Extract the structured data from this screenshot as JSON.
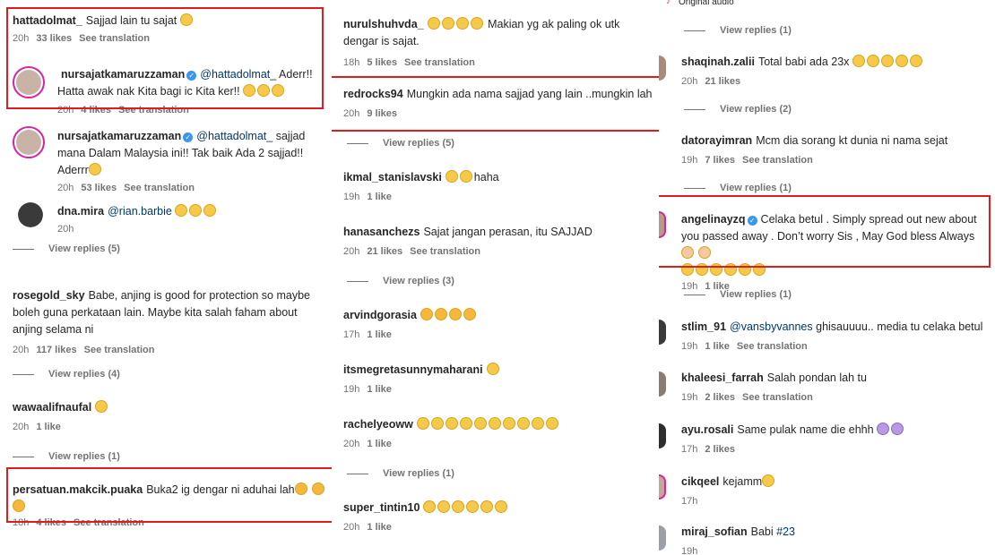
{
  "col1": {
    "c1": {
      "user": "hattadolmat_",
      "text": "Sajjad lain tu sajat",
      "time": "20h",
      "likes": "33 likes",
      "see": "See translation"
    },
    "c2": {
      "user": "nursajatkamaruzzaman",
      "mention": "@hattadolmat_",
      "text": "Aderr!! Hatta awak nak Kita bagi ic Kita ker!!",
      "time": "20h",
      "likes": "4 likes",
      "see": "See translation"
    },
    "c3": {
      "user": "nursajatkamaruzzaman",
      "mention": "@hattadolmat_",
      "text": "sajjad mana Dalam Malaysia ini!! Tak baik Ada 2 sajjad!! Aderrr",
      "time": "20h",
      "likes": "53 likes",
      "see": "See translation"
    },
    "c4": {
      "user": "dna.mira",
      "mention": "@rian.barbie",
      "time": "20h"
    },
    "vr1": "View replies (5)",
    "c5": {
      "user": "rosegold_sky",
      "text": "Babe, anjing is good for protection so maybe boleh guna perkataan lain. Maybe kita salah faham about anjing selama ni",
      "time": "20h",
      "likes": "117 likes",
      "see": "See translation"
    },
    "vr2": "View replies (4)",
    "c6": {
      "user": "wawaalifnaufal",
      "time": "20h",
      "likes": "1 like"
    },
    "vr3": "View replies (1)",
    "c7": {
      "user": "persatuan.makcik.puaka",
      "text": "Buka2 ig dengar ni aduhai lah",
      "time": "18h",
      "likes": "4 likes",
      "see": "See translation"
    }
  },
  "col2": {
    "c1": {
      "user": "nurulshuhvda_",
      "text": "Makian yg ak paling ok utk dengar is sajat.",
      "time": "18h",
      "likes": "5 likes",
      "see": "See translation"
    },
    "c2": {
      "user": "redrocks94",
      "text": "Mungkin ada nama sajjad yang lain ..mungkin lah",
      "time": "20h",
      "likes": "9 likes"
    },
    "vr1": "View replies (5)",
    "c3": {
      "user": "ikmal_stanislavski",
      "text": "haha",
      "time": "19h",
      "likes": "1 like"
    },
    "c4": {
      "user": "hanasanchezs",
      "text": "Sajat jangan perasan, itu SAJJAD",
      "time": "20h",
      "likes": "21 likes",
      "see": "See translation"
    },
    "vr2": "View replies (3)",
    "c5": {
      "user": "arvindgorasia",
      "time": "17h",
      "likes": "1 like"
    },
    "c6": {
      "user": "itsmegretasunnymaharani",
      "time": "19h",
      "likes": "1 like"
    },
    "c7": {
      "user": "rachelyeoww",
      "time": "20h",
      "likes": "1 like"
    },
    "vr3": "View replies (1)",
    "c8": {
      "user": "super_tintin10",
      "time": "20h",
      "likes": "1 like"
    }
  },
  "col3": {
    "top": "Original audio",
    "vr1": "View replies (1)",
    "c1": {
      "user": "shaqinah.zalii",
      "text": "Total babi ada 23x",
      "time": "20h",
      "likes": "21 likes"
    },
    "vr2": "View replies (2)",
    "c2": {
      "user": "datorayimran",
      "text": "Mcm dia sorang kt dunia ni nama sejat",
      "time": "19h",
      "likes": "7 likes",
      "see": "See translation"
    },
    "vr3": "View replies (1)",
    "c3": {
      "user": "angelinayzq",
      "text": "Celaka betul . Simply spread out new about you passed away . Don’t worry Sis , May God bless Always",
      "time": "19h",
      "likes": "1 like"
    },
    "vr4": "View replies (1)",
    "c4": {
      "user": "stlim_91",
      "mention": "@vansbyvannes",
      "text": "ghisauuuu.. media tu celaka betul",
      "time": "19h",
      "likes": "1 like",
      "see": "See translation"
    },
    "c5": {
      "user": "khaleesi_farrah",
      "text": "Salah pondan lah tu",
      "time": "19h",
      "likes": "2 likes",
      "see": "See translation"
    },
    "c6": {
      "user": "ayu.rosali",
      "text": "Same pulak name die ehhh",
      "time": "17h",
      "likes": "2 likes"
    },
    "c7": {
      "user": "cikqeel",
      "text": "kejamm",
      "time": "17h"
    },
    "c8": {
      "user": "miraj_sofian",
      "text": "Babi",
      "hashtag": "#23",
      "time": "19h"
    }
  },
  "colors": {
    "highlight": "#e01b1b",
    "verified": "#3897f0",
    "mention": "#00376b",
    "meta": "#737373"
  }
}
